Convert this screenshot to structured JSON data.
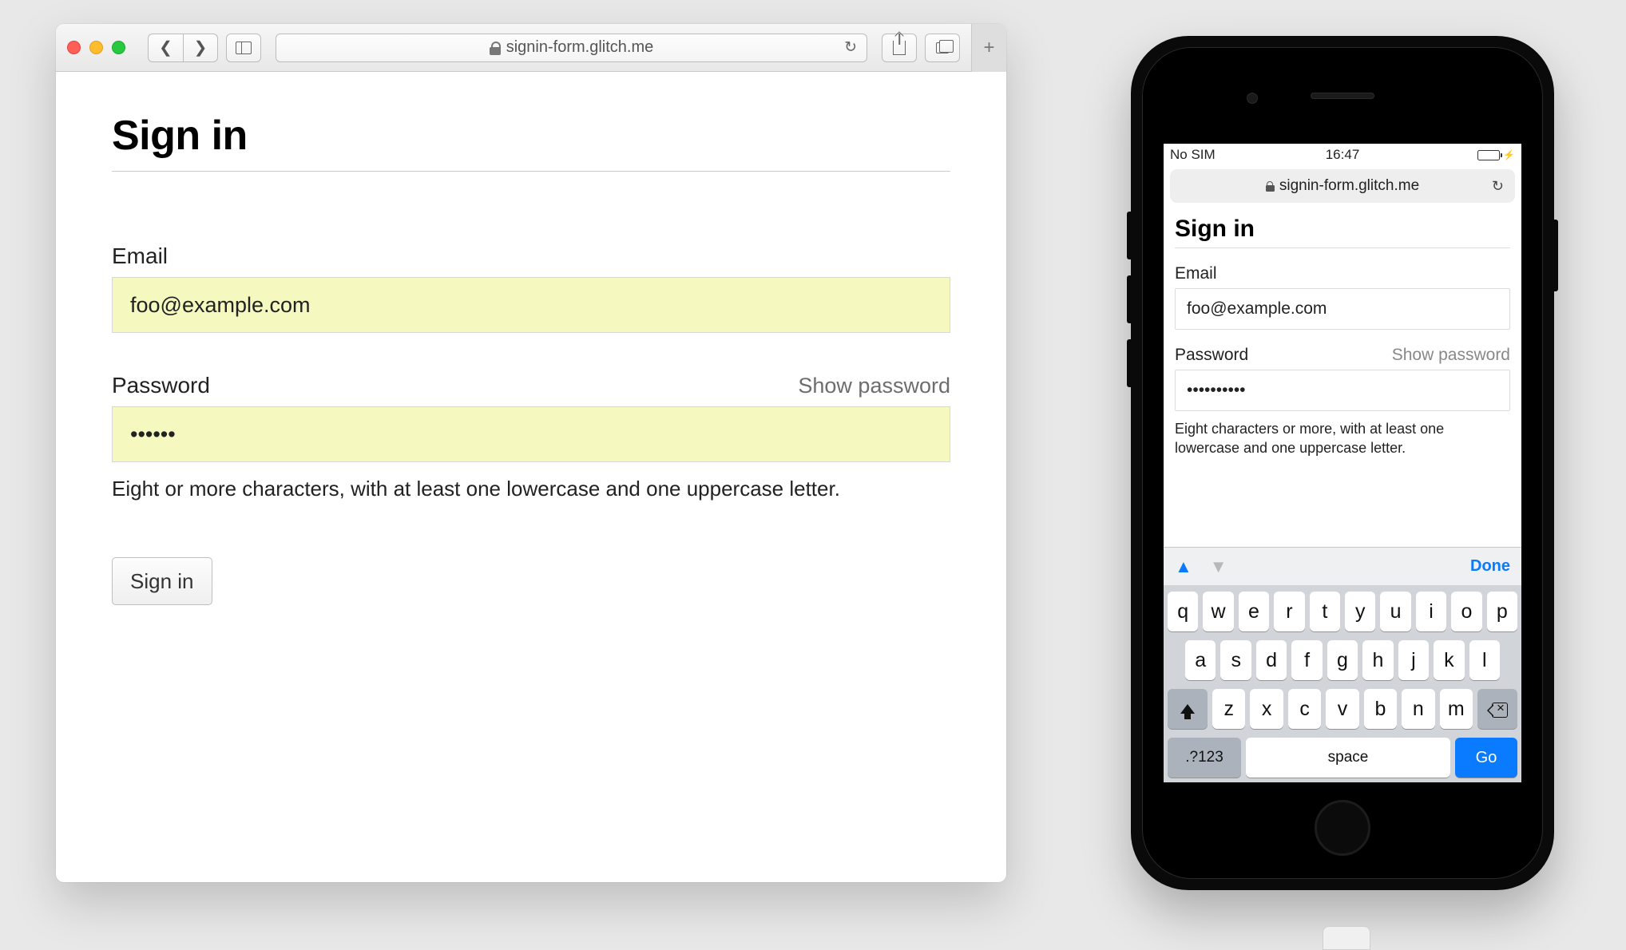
{
  "desktop": {
    "url": "signin-form.glitch.me",
    "page": {
      "title": "Sign in",
      "email": {
        "label": "Email",
        "value": "foo@example.com"
      },
      "password": {
        "label": "Password",
        "show_label": "Show password",
        "value_masked": "••••••",
        "hint": "Eight or more characters, with at least one lowercase and one uppercase letter."
      },
      "submit_label": "Sign in"
    }
  },
  "mobile": {
    "status": {
      "carrier": "No SIM",
      "time": "16:47"
    },
    "url": "signin-form.glitch.me",
    "page": {
      "title": "Sign in",
      "email": {
        "label": "Email",
        "value": "foo@example.com"
      },
      "password": {
        "label": "Password",
        "show_label": "Show password",
        "value_masked": "••••••••••",
        "hint": "Eight characters or more, with at least one lowercase and one uppercase letter."
      }
    },
    "keyboard": {
      "done_label": "Done",
      "row1": [
        "q",
        "w",
        "e",
        "r",
        "t",
        "y",
        "u",
        "i",
        "o",
        "p"
      ],
      "row2": [
        "a",
        "s",
        "d",
        "f",
        "g",
        "h",
        "j",
        "k",
        "l"
      ],
      "row3": [
        "z",
        "x",
        "c",
        "v",
        "b",
        "n",
        "m"
      ],
      "num_key": ".?123",
      "space_label": "space",
      "go_label": "Go"
    }
  }
}
